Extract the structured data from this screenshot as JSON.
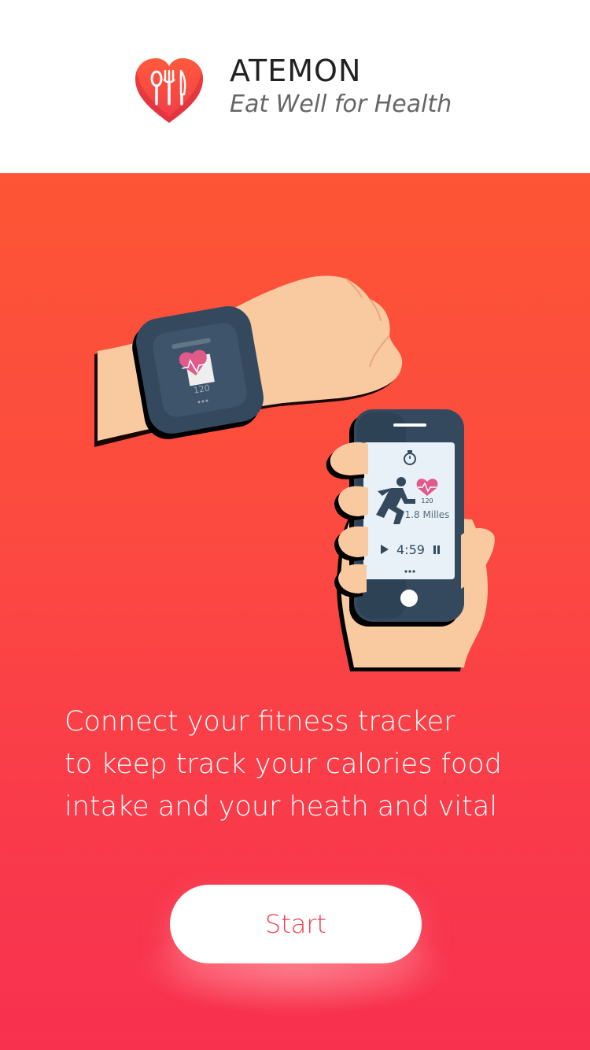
{
  "header": {
    "title": "ATEMON",
    "subtitle": "Eat Well for Health",
    "logo_icon": "heart-cutlery-icon"
  },
  "illustration": {
    "watch": {
      "heart_rate": "120"
    },
    "phone": {
      "heart_rate": "120",
      "distance": "1.8 Milles",
      "timer": "4:59"
    }
  },
  "main": {
    "description_lines": [
      "Connect your fitness tracker",
      "to keep track your calories food",
      "intake and your heath and vital"
    ],
    "start_label": "Start"
  },
  "colors": {
    "accent": "#f53a4d",
    "gradient_top": "#fd5535",
    "gradient_bottom": "#f8314f",
    "device_dark": "#34495e",
    "skin": "#f9c9a0"
  }
}
